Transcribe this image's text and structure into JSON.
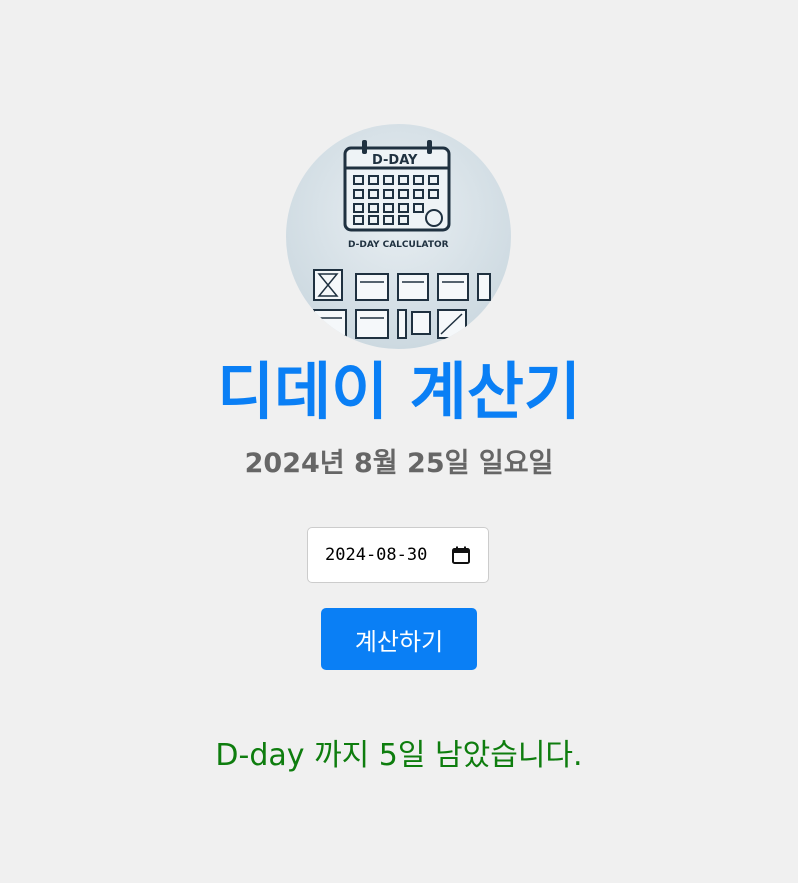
{
  "logo": {
    "image_text": "D-DAY",
    "image_caption": "D-DAY CALCULATOR"
  },
  "title": "디데이 계산기",
  "today_text": "2024년 8월 25일 일요일",
  "date_input": {
    "value": "2024-08-30",
    "icon": "calendar-icon"
  },
  "calculate_button_label": "계산하기",
  "result_text": "D-day 까지 5일 남았습니다.",
  "colors": {
    "accent": "#0a7ff5",
    "subtitle": "#666666",
    "result": "#0e7d0e",
    "background": "#f0f0f0"
  }
}
